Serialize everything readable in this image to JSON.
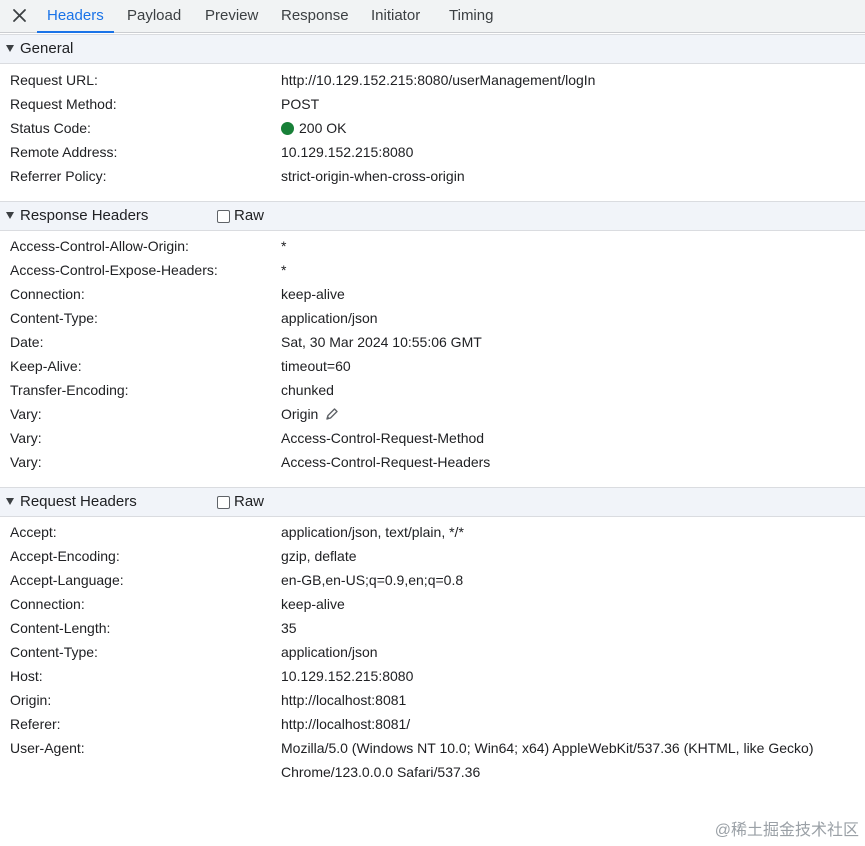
{
  "tabs": [
    "Headers",
    "Payload",
    "Preview",
    "Response",
    "Initiator",
    "Timing"
  ],
  "active_tab": "Headers",
  "general": {
    "title": "General",
    "rows": [
      {
        "key": "Request URL:",
        "value": "http://10.129.152.215:8080/userManagement/logIn"
      },
      {
        "key": "Request Method:",
        "value": "POST"
      },
      {
        "key": "Status Code:",
        "value": "200 OK",
        "status_color": "#188038"
      },
      {
        "key": "Remote Address:",
        "value": "10.129.152.215:8080"
      },
      {
        "key": "Referrer Policy:",
        "value": "strict-origin-when-cross-origin"
      }
    ]
  },
  "response_headers": {
    "title": "Response Headers",
    "raw_label": "Raw",
    "raw_checked": false,
    "rows": [
      {
        "key": "Access-Control-Allow-Origin:",
        "value": "*"
      },
      {
        "key": "Access-Control-Expose-Headers:",
        "value": "*"
      },
      {
        "key": "Connection:",
        "value": "keep-alive"
      },
      {
        "key": "Content-Type:",
        "value": "application/json"
      },
      {
        "key": "Date:",
        "value": "Sat, 30 Mar 2024 10:55:06 GMT"
      },
      {
        "key": "Keep-Alive:",
        "value": "timeout=60"
      },
      {
        "key": "Transfer-Encoding:",
        "value": "chunked"
      },
      {
        "key": "Vary:",
        "value": "Origin",
        "edit_icon": "pencil-icon"
      },
      {
        "key": "Vary:",
        "value": "Access-Control-Request-Method"
      },
      {
        "key": "Vary:",
        "value": "Access-Control-Request-Headers"
      }
    ]
  },
  "request_headers": {
    "title": "Request Headers",
    "raw_label": "Raw",
    "raw_checked": false,
    "rows": [
      {
        "key": "Accept:",
        "value": "application/json, text/plain, */*"
      },
      {
        "key": "Accept-Encoding:",
        "value": "gzip, deflate"
      },
      {
        "key": "Accept-Language:",
        "value": "en-GB,en-US;q=0.9,en;q=0.8"
      },
      {
        "key": "Connection:",
        "value": "keep-alive"
      },
      {
        "key": "Content-Length:",
        "value": "35"
      },
      {
        "key": "Content-Type:",
        "value": "application/json"
      },
      {
        "key": "Host:",
        "value": "10.129.152.215:8080"
      },
      {
        "key": "Origin:",
        "value": "http://localhost:8081"
      },
      {
        "key": "Referer:",
        "value": "http://localhost:8081/"
      },
      {
        "key": "User-Agent:",
        "value": "Mozilla/5.0 (Windows NT 10.0; Win64; x64) AppleWebKit/537.36 (KHTML, like Gecko) Chrome/123.0.0.0 Safari/537.36"
      }
    ]
  },
  "watermark": "@稀土掘金技术社区",
  "colors": {
    "accent": "#1a73e8",
    "status_ok": "#188038",
    "section_bg": "#f1f4f9"
  }
}
